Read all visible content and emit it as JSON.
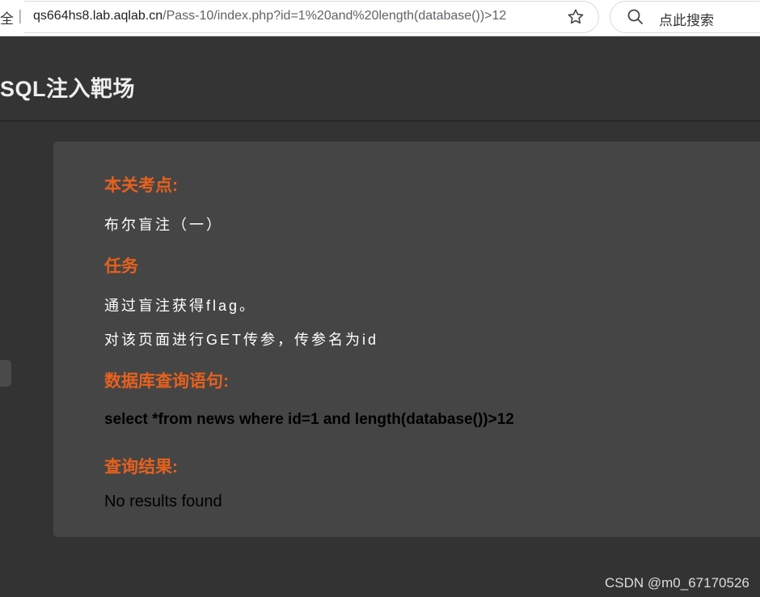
{
  "browser": {
    "security_text": "全",
    "separator": "|",
    "url_host": "qs664hs8.lab.aqlab.cn",
    "url_path": "/Pass-10/index.php?id=1%20and%20length(database())>12",
    "search_placeholder": "点此搜索"
  },
  "site": {
    "title": "SQL注入靶场"
  },
  "panel": {
    "topic_heading": "本关考点:",
    "topic_text": "布尔盲注（一）",
    "task_heading": "任务",
    "task_lines": [
      "通过盲注获得flag。",
      "对该页面进行GET传参，传参名为id"
    ],
    "query_heading": "数据库查询语句:",
    "query_text": "select *from news where id=1 and length(database())>12",
    "result_heading": "查询结果:",
    "result_text": "No results found"
  },
  "watermark": "CSDN @m0_67170526",
  "colors": {
    "accent": "#e6611d",
    "page_bg": "#333333",
    "panel_bg": "#454545"
  }
}
